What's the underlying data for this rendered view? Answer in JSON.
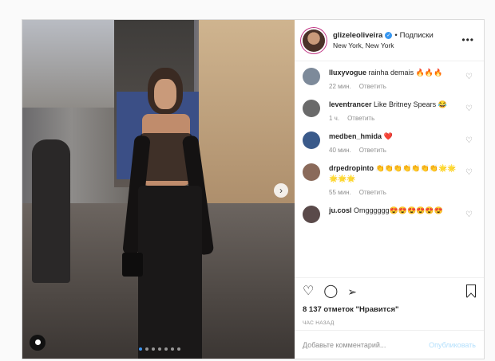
{
  "post": {
    "username": "glizeleoliveira",
    "separator": "•",
    "follow_label": "Подписки",
    "location": "New York, New York",
    "more_label": "•••",
    "slides": 7,
    "active_slide": 1
  },
  "comments": [
    {
      "user": "lluxyvogue",
      "text": "rainha demais 🔥🔥🔥",
      "time": "22 мин.",
      "reply": "Ответить",
      "avatar_color": "#7d8a9a"
    },
    {
      "user": "leventrancer",
      "text": "Like Britney Spears 😂",
      "time": "1 ч.",
      "reply": "Ответить",
      "avatar_color": "#6a6a6a"
    },
    {
      "user": "medben_hmida",
      "text": "❤️",
      "time": "40 мин.",
      "reply": "Ответить",
      "avatar_color": "#3a5a8a"
    },
    {
      "user": "drpedropinto",
      "text": "👏👏👏👏👏👏👏🌟🌟🌟🌟🌟",
      "time": "55 мин.",
      "reply": "Ответить",
      "avatar_color": "#8a6a5a"
    },
    {
      "user": "ju.cosl",
      "text": "Omgggggg😍😍😍😍😍😍",
      "time": "",
      "reply": "",
      "avatar_color": "#5a4a4a"
    }
  ],
  "actions": {
    "like_icon": "heart-icon",
    "comment_icon": "comment-icon",
    "share_icon": "share-icon",
    "save_icon": "bookmark-icon",
    "likes_text": "8 137 отметок \"Нравится\"",
    "time_text": "час назад"
  },
  "add_comment": {
    "placeholder": "Добавьте комментарий...",
    "publish_label": "Опубликовать"
  },
  "colors": {
    "accent": "#3897f0",
    "publish_disabled": "#b2dffc",
    "border": "#dbdbdb"
  }
}
